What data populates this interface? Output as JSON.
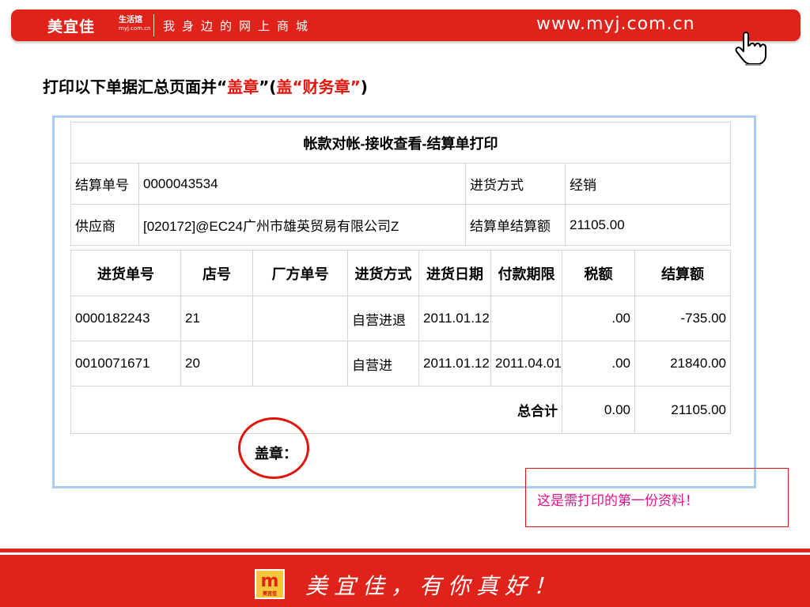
{
  "banner": {
    "brand": "美宜佳",
    "brand_sub_1": "生活馆",
    "brand_sub_2": "myj.com.cn",
    "slogan": "我身边的网上商城",
    "url": "www.myj.com.cn"
  },
  "heading": {
    "p1": "打印以下单据汇总页面并“",
    "p2": "盖章",
    "p3": "”(",
    "p4": "盖“财务章”",
    "p5": ")"
  },
  "header_table": {
    "title": "帐款对帐-接收查看-结算单打印",
    "settle_no_label": "结算单号",
    "settle_no": "0000043534",
    "purchase_method_label": "进货方式",
    "purchase_method": "经销",
    "supplier_label": "供应商",
    "supplier": "[020172]@EC24广州市雄英贸易有限公司Z",
    "settle_amount_label": "结算单结算额",
    "settle_amount": "21105.00"
  },
  "detail_table": {
    "columns": [
      "进货单号",
      "店号",
      "厂方单号",
      "进货方式",
      "进货日期",
      "付款期限",
      "税额",
      "结算额"
    ],
    "rows": [
      [
        "0000182243",
        "21",
        "",
        "自营进退",
        "2011.01.12",
        "",
        ".00",
        "-735.00"
      ],
      [
        "0010071671",
        "20",
        "",
        "自营进",
        "2011.01.12",
        "2011.04.01",
        ".00",
        "21840.00"
      ]
    ],
    "total_label": "总合计",
    "total_tax": "0.00",
    "total_amount": "21105.00"
  },
  "stamp_label": "盖章：",
  "note": "这是需打印的第一份资料！",
  "footer": {
    "logo_mark": "m",
    "logo_caption": "美宜佳",
    "slogan": "美宜佳，有你真好！"
  },
  "colors": {
    "brand_red": "#e0231a",
    "frame_blue": "#a8cdee",
    "note_pink": "#e0168c"
  }
}
